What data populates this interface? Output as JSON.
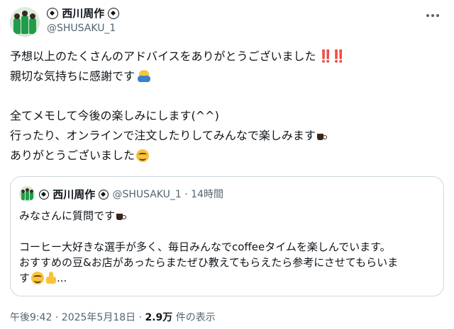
{
  "author": {
    "display_name": "西川周作",
    "handle": "@SHUSAKU_1"
  },
  "tweet": {
    "line1": "予想以上のたくさんのアドバイスをありがとうございました",
    "line1_emoji": "‼️‼️",
    "line2": "親切な気持ちに感謝です",
    "line3": "全てメモして今後の楽しみにします(^^)",
    "line4": "行ったり、オンラインで注文したりしてみんなで楽しみます",
    "line5": "ありがとうございました"
  },
  "quoted": {
    "display_name": "西川周作",
    "meta": "@SHUSAKU_1 · 14時間",
    "line1": "みなさんに質問です",
    "line2": "コーヒー大好きな選手が多く、毎日みんなでcoffeeタイムを楽しんでいます。",
    "line3": "おすすめの豆&お店があったらまたぜひ教えてもらえたら参考にさせてもらいま",
    "line4": "す",
    "line4_ellipsis": "..."
  },
  "footer": {
    "timestamp": "午後9:42 · 2025年5月18日 · ",
    "views_count": "2.9万",
    "views_label": " 件の表示"
  },
  "icons": [
    "soccer-ball-icon",
    "more-icon",
    "bowing-person-icon",
    "coffee-icon",
    "smiling-face-icon",
    "thumbs-up-icon"
  ],
  "colors": {
    "text": "#0f1419",
    "secondary": "#536471",
    "border": "#cfd9de",
    "exclamation": "#d0021b"
  }
}
